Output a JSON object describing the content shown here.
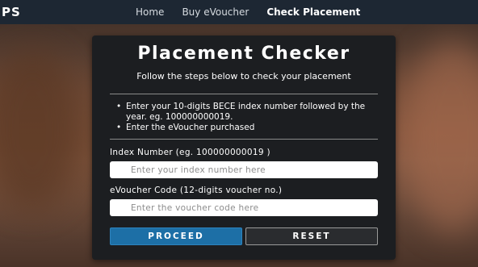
{
  "nav": {
    "brand": "PS",
    "links": [
      "Home",
      "Buy eVoucher",
      "Check Placement"
    ],
    "active": "Check Placement"
  },
  "card": {
    "title": "Placement Checker",
    "subtitle": "Follow the steps below to check your placement",
    "steps": [
      "Enter your 10-digits BECE index number followed by the year. eg. 100000000019.",
      "Enter the eVoucher purchased"
    ],
    "index_field": {
      "label": "Index Number (eg. 100000000019 )",
      "placeholder": "Enter your index number here",
      "value": ""
    },
    "voucher_field": {
      "label": "eVoucher Code (12-digits voucher no.)",
      "placeholder": "Enter the voucher code here",
      "value": ""
    },
    "proceed_label": "PROCEED",
    "reset_label": "RESET"
  },
  "colors": {
    "nav_bg": "#1d2733",
    "card_bg": "#1c1e21",
    "proceed_bg": "#1d6fa6"
  }
}
